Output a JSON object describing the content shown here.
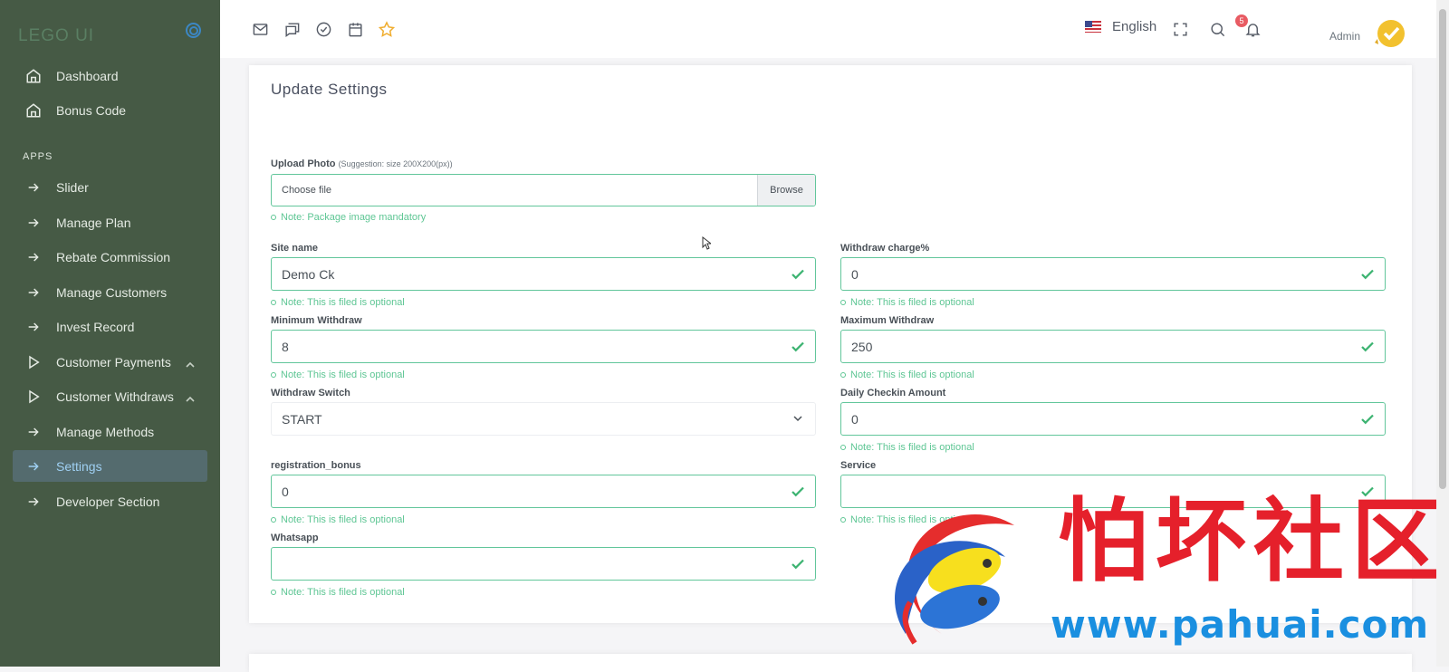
{
  "sidebar": {
    "brand": "LEGO UI",
    "menu_top": [
      {
        "label": "Dashboard",
        "icon": "home-icon"
      },
      {
        "label": "Bonus Code",
        "icon": "home-icon"
      }
    ],
    "section_label": "APPS",
    "apps": [
      {
        "label": "Slider",
        "icon": "arrow-right-icon"
      },
      {
        "label": "Manage Plan",
        "icon": "arrow-right-icon"
      },
      {
        "label": "Rebate Commission",
        "icon": "arrow-right-icon"
      },
      {
        "label": "Manage Customers",
        "icon": "arrow-right-icon"
      },
      {
        "label": "Invest Record",
        "icon": "arrow-right-icon"
      },
      {
        "label": "Customer Payments",
        "icon": "play-icon"
      },
      {
        "label": "Customer Withdraws",
        "icon": "play-icon"
      },
      {
        "label": "Manage Methods",
        "icon": "arrow-right-icon"
      },
      {
        "label": "Settings",
        "icon": "arrow-right-icon",
        "active": true
      },
      {
        "label": "Developer Section",
        "icon": "arrow-right-icon"
      }
    ]
  },
  "topbar": {
    "language": "English",
    "notification_count": "5",
    "user": "Admin"
  },
  "form": {
    "title": "Update Settings",
    "upload": {
      "label": "Upload Photo",
      "hint": "(Suggestion: size 200X200(px))",
      "placeholder": "Choose file",
      "browse": "Browse",
      "note": "Note: Package image mandatory"
    },
    "site_name": {
      "label": "Site name",
      "value": "Demo Ck",
      "note": "Note: This is filed is optional"
    },
    "withdraw_charge": {
      "label": "Withdraw charge%",
      "value": "0",
      "note": "Note: This is filed is optional"
    },
    "min_withdraw": {
      "label": "Minimum Withdraw",
      "value": "8",
      "note": "Note: This is filed is optional"
    },
    "max_withdraw": {
      "label": "Maximum Withdraw",
      "value": "250",
      "note": "Note: This is filed is optional"
    },
    "withdraw_switch": {
      "label": "Withdraw Switch",
      "value": "START"
    },
    "daily_checkin": {
      "label": "Daily Checkin Amount",
      "value": "0",
      "note": "Note: This is filed is optional"
    },
    "registration_bonus": {
      "label": "registration_bonus",
      "value": "0",
      "note": "Note: This is filed is optional"
    },
    "service": {
      "label": "Service",
      "value": "",
      "note": "Note: This is filed is optional"
    },
    "whatsapp": {
      "label": "Whatsapp",
      "value": "",
      "note": "Note: This is filed is optional"
    }
  },
  "watermark": {
    "chinese": "怕坏社区",
    "url": "www.pahuai.com"
  },
  "colors": {
    "sidebar_bg": "#465a45",
    "active_item_bg": "#546b6e",
    "input_border": "#62c69b",
    "note_text": "#5ec694",
    "badge": "#e85b63"
  }
}
